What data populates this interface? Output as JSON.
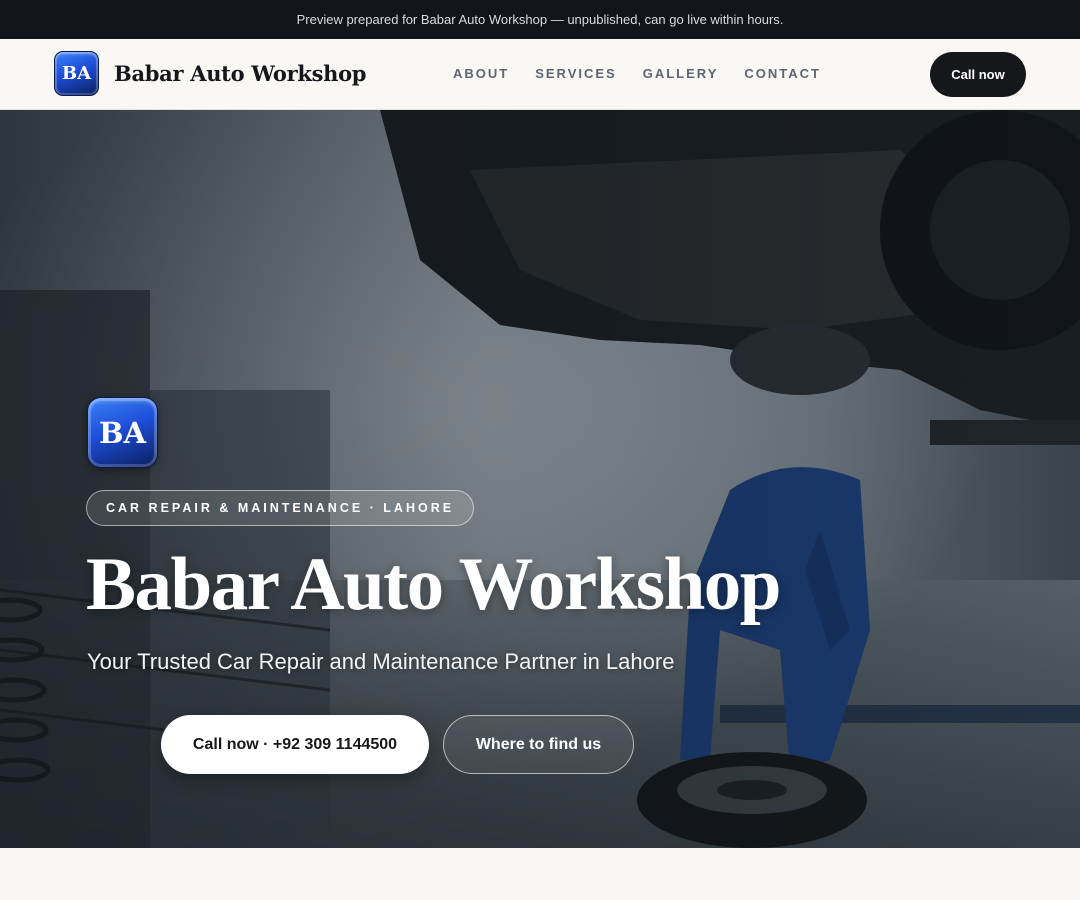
{
  "announcement": "Preview prepared for Babar Auto Workshop — unpublished, can go live within hours.",
  "brand": {
    "logo_text": "BA",
    "name": "Babar Auto Workshop"
  },
  "nav": {
    "links": [
      "ABOUT",
      "SERVICES",
      "GALLERY",
      "CONTACT"
    ],
    "cta": "Call now"
  },
  "hero": {
    "logo_text": "BA",
    "tagline": "CAR REPAIR & MAINTENANCE · LAHORE",
    "title": "Babar Auto Workshop",
    "subtitle": "Your Trusted Car Repair and Maintenance Partner in Lahore",
    "primary_button": "Call now · +92 309 1144500",
    "secondary_button": "Where to find us",
    "background_image": "mechanic-working-under-lifted-car-photo"
  },
  "colors": {
    "dark": "#15171b",
    "announce_bg": "#111418",
    "logo_blue": "#1d4ed8",
    "page_bg": "#f8f7f4"
  }
}
